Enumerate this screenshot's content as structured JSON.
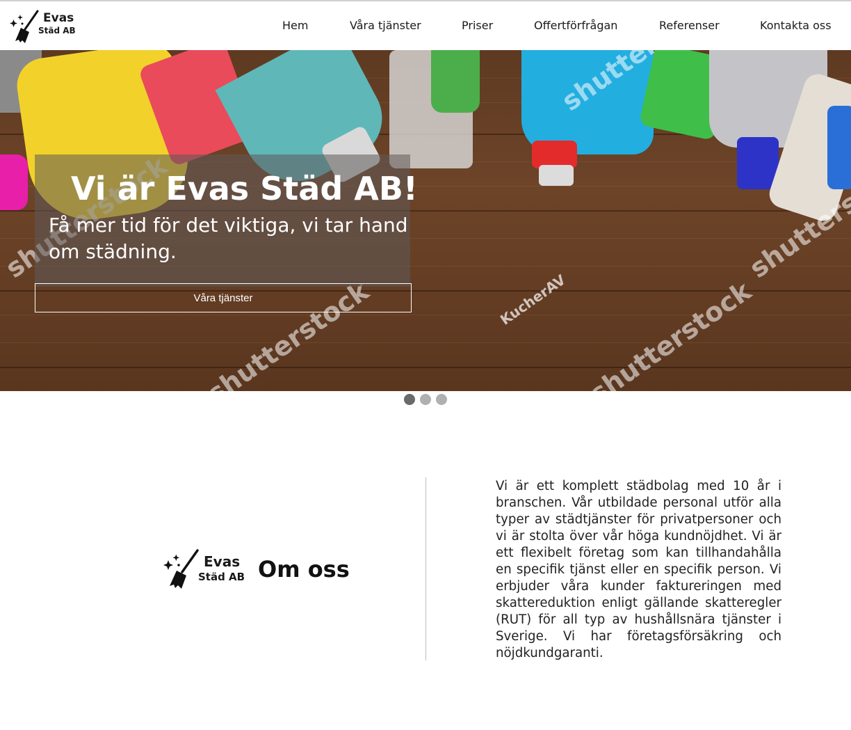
{
  "header": {
    "logo": {
      "line1": "Evas",
      "line2": "Städ AB"
    },
    "nav": [
      {
        "label": "Hem"
      },
      {
        "label": "Våra tjänster"
      },
      {
        "label": "Priser"
      },
      {
        "label": "Offertförfrågan"
      },
      {
        "label": "Referenser"
      },
      {
        "label": "Kontakta oss"
      }
    ]
  },
  "hero": {
    "title": "Vi är Evas Städ AB!",
    "subtitle": "Få mer tid för det viktiga, vi tar hand om städning.",
    "button_label": "Våra tjänster",
    "watermark": "shutterstock",
    "watermark_author": "KucherAV",
    "slides": {
      "count": 3,
      "active": 1
    }
  },
  "about": {
    "logo": {
      "line1": "Evas",
      "line2": "Städ AB"
    },
    "title": "Om oss",
    "text": "Vi är ett komplett städbolag med 10 år i branschen. Vår utbildade personal utför alla typer av städtjänster för privatpersoner och vi är stolta över vår höga kundnöjdhet. Vi är ett flexibelt företag som kan tillhandahålla en specifik tjänst eller en specifik person. Vi erbjuder våra kunder faktureringen med skattereduktion enligt gällande skatteregler (RUT) för all typ av hushållsnära tjänster i Sverige. Vi har företagsförsäkring och nöjdkundgaranti."
  }
}
